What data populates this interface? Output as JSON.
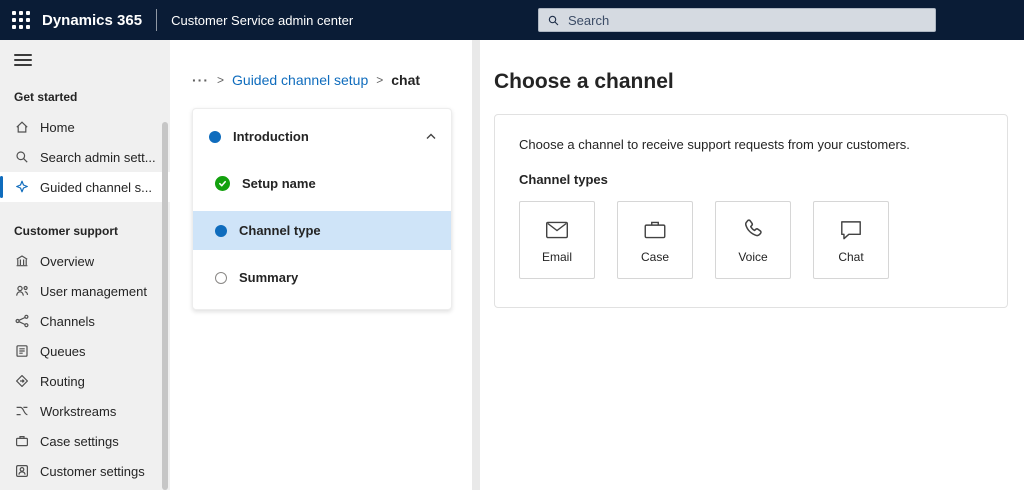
{
  "topbar": {
    "brand": "Dynamics 365",
    "app_title": "Customer Service admin center",
    "search_placeholder": "Search"
  },
  "sidebar": {
    "sections": [
      {
        "header": "Get started",
        "items": [
          {
            "label": "Home",
            "icon": "home-icon",
            "selected": false
          },
          {
            "label": "Search admin sett...",
            "icon": "search-icon",
            "selected": false
          },
          {
            "label": "Guided channel s...",
            "icon": "guided-channel-setup-icon",
            "selected": true
          }
        ]
      },
      {
        "header": "Customer support",
        "items": [
          {
            "label": "Overview",
            "icon": "overview-icon",
            "selected": false
          },
          {
            "label": "User management",
            "icon": "user-management-icon",
            "selected": false
          },
          {
            "label": "Channels",
            "icon": "channels-icon",
            "selected": false
          },
          {
            "label": "Queues",
            "icon": "queues-icon",
            "selected": false
          },
          {
            "label": "Routing",
            "icon": "routing-icon",
            "selected": false
          },
          {
            "label": "Workstreams",
            "icon": "workstreams-icon",
            "selected": false
          },
          {
            "label": "Case settings",
            "icon": "case-settings-icon",
            "selected": false
          },
          {
            "label": "Customer settings",
            "icon": "customer-settings-icon",
            "selected": false
          }
        ]
      }
    ]
  },
  "breadcrumb": {
    "ellipsis": "···",
    "separator": ">",
    "parent": "Guided channel setup",
    "current": "chat"
  },
  "wizard": {
    "steps": [
      {
        "label": "Introduction",
        "state": "current-parent"
      },
      {
        "label": "Setup name",
        "state": "done"
      },
      {
        "label": "Channel type",
        "state": "current"
      },
      {
        "label": "Summary",
        "state": "todo"
      }
    ]
  },
  "main": {
    "title": "Choose a channel",
    "card": {
      "description": "Choose a channel to receive support requests from your customers.",
      "channel_types_label": "Channel types",
      "channels": [
        {
          "label": "Email",
          "icon": "email-icon"
        },
        {
          "label": "Case",
          "icon": "case-icon"
        },
        {
          "label": "Voice",
          "icon": "voice-icon"
        },
        {
          "label": "Chat",
          "icon": "chat-icon"
        }
      ]
    }
  },
  "colors": {
    "topbar-bg": "#0a1c36",
    "accent": "#0f6cbd",
    "link": "#0f6cbd",
    "green": "#13a10e",
    "sidebar-bg": "#f0f0f0",
    "selected-step-bg": "#cfe4f8",
    "search-bg": "#d5dae1"
  }
}
